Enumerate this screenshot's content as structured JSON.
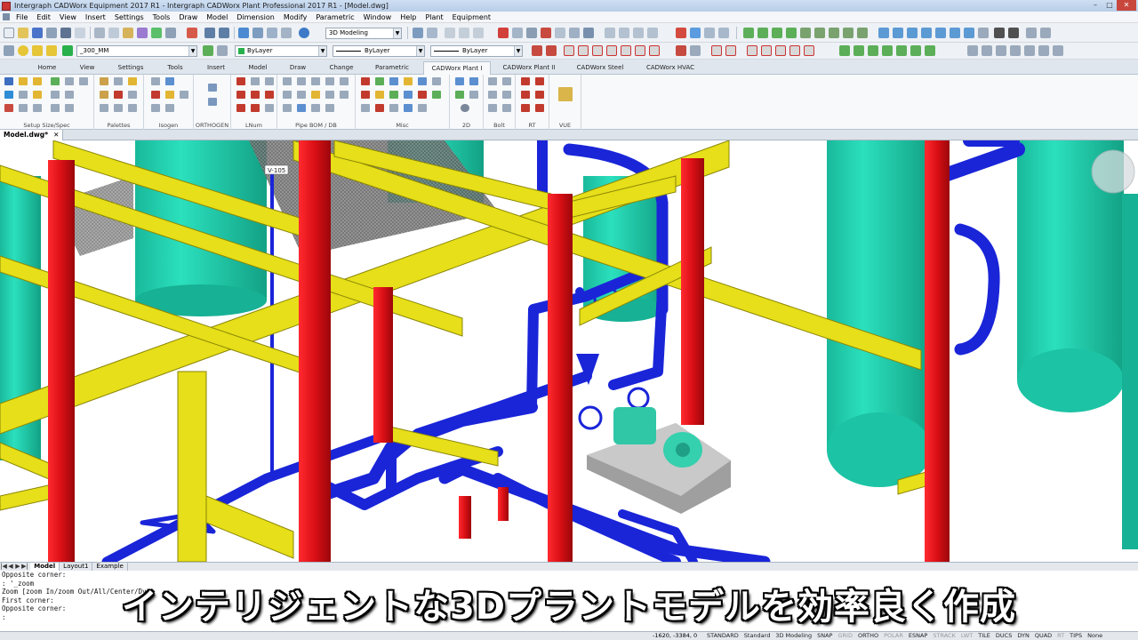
{
  "window": {
    "title": "Intergraph CADWorx Equipment 2017 R1 - Intergraph CADWorx Plant Professional 2017 R1 - [Model.dwg]"
  },
  "menubar": {
    "items": [
      "File",
      "Edit",
      "View",
      "Insert",
      "Settings",
      "Tools",
      "Draw",
      "Model",
      "Dimension",
      "Modify",
      "Parametric",
      "Window",
      "Help",
      "Plant",
      "Equipment"
    ]
  },
  "toolbar1": {
    "workspace": "3D Modeling"
  },
  "toolbar2": {
    "layer": "_300_MM",
    "color": "ByLayer",
    "linetype": "ByLayer",
    "lineweight": "ByLayer"
  },
  "ribbon": {
    "tabs": [
      "Home",
      "View",
      "Settings",
      "Tools",
      "Insert",
      "Model",
      "Draw",
      "Change",
      "Parametric",
      "CADWorx Plant I",
      "CADWorx Plant II",
      "CADWorx Steel",
      "CADWorx HVAC"
    ],
    "active_tab": "CADWorx Plant I",
    "groups": [
      "Setup Size/Spec",
      "Palettes",
      "Isogen",
      "ORTHOGEN",
      "LNum",
      "Pipe BOM / DB",
      "Misc",
      "2D",
      "Bolt",
      "RT",
      "VUE"
    ]
  },
  "document": {
    "tab_label": "Model.dwg*",
    "close": "✕"
  },
  "viewport": {
    "tag_label": "V-105"
  },
  "layout_tabs": {
    "nav": [
      "|◀",
      "◀",
      "▶",
      "▶|"
    ],
    "tabs": [
      "Model",
      "Layout1",
      "Example"
    ],
    "active": "Model"
  },
  "command_line": {
    "lines": [
      "Opposite corner:",
      ": '_zoom",
      "Zoom [zoom In/zoom Out/All/Center/Dy",
      "First corner:",
      "Opposite corner:",
      ":"
    ]
  },
  "statusbar": {
    "coords": "-1620, -3384, 0",
    "items": [
      "STANDARD",
      "Standard",
      "3D Modeling",
      "SNAP",
      "GRID",
      "ORTHO",
      "POLAR",
      "ESNAP",
      "STRACK",
      "LWT",
      "TILE",
      "DUCS",
      "DYN",
      "QUAD",
      "RT",
      "TIPS",
      "None"
    ]
  },
  "subtitle": {
    "text": "インテリジェントな3Dプラントモデルを効率良く作成"
  },
  "colors": {
    "vessel": "#22d1b0",
    "vessel_dark": "#14a98c",
    "steel_column": "#e0161c",
    "steel_beam": "#e9e21a",
    "pipe": "#1624d6",
    "pump": "#35c9a8",
    "pump_base": "#b9b9b9"
  }
}
